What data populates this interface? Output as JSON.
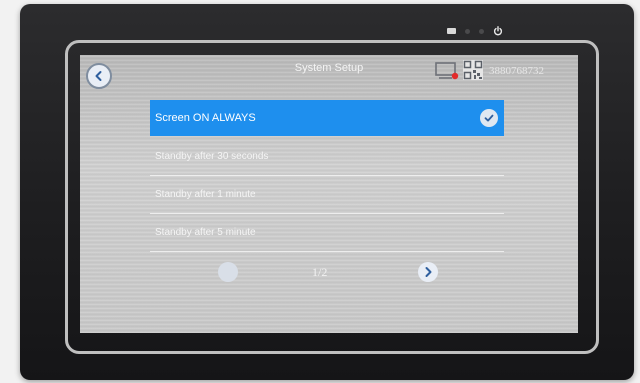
{
  "header": {
    "title": "System Setup",
    "device_id": "3880768732",
    "icons": [
      "back-icon",
      "device-status-icon",
      "qr-code-icon"
    ]
  },
  "options": [
    {
      "label": "Screen ON ALWAYS",
      "selected": true
    },
    {
      "label": "Standby after 30 seconds",
      "selected": false
    },
    {
      "label": "Standby after 1 minute",
      "selected": false
    },
    {
      "label": "Standby after 5 minute",
      "selected": false
    }
  ],
  "pager": {
    "page_indicator": "1/2"
  },
  "colors": {
    "selected_background": "#1e8fee",
    "status_dot": "#e22b2b"
  }
}
